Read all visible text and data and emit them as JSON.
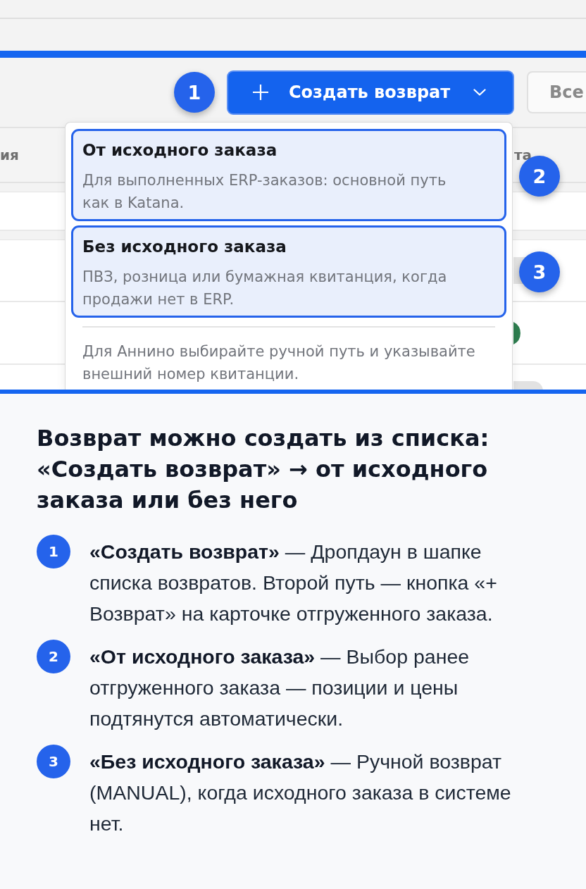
{
  "screenshot": {
    "toolbar": {
      "create_button": {
        "label": "Создать возврат"
      },
      "filter_button": {
        "label": "Все"
      }
    },
    "table": {
      "columns": [
        {
          "label": "ия"
        },
        {
          "label": "та"
        }
      ],
      "rows": [
        {
          "kind": "chip",
          "color": "#e4e4e4"
        },
        {
          "kind": "dot",
          "color": "#2e7d4f"
        },
        {
          "kind": "pill",
          "color": "#e2e2e2"
        }
      ]
    },
    "dropdown": {
      "options": [
        {
          "title": "От исходного заказа",
          "description": "Для выполненных ERP-заказов: основной путь как в Katana.",
          "highlighted": true
        },
        {
          "title": "Без исходного заказа",
          "description": "ПВЗ, розница или бумажная квитанция, когда продажи нет в ERP.",
          "highlighted": true
        }
      ],
      "note": "Для Аннино выбирайте ручной путь и указывайте внешний номер квитанции."
    },
    "callouts": [
      {
        "number": "1"
      },
      {
        "number": "2"
      },
      {
        "number": "3"
      }
    ]
  },
  "explanation": {
    "heading": "Возврат можно создать из списка: «Создать возврат» → от исходного заказа или без него",
    "steps": [
      {
        "number": "1",
        "text": "**«Создать возврат»** — Дропдаун в шапке списка возвратов. Второй путь — кнопка «+ Возврат» на карточке отгруженного заказа."
      },
      {
        "number": "2",
        "text": "**«От исходного заказа»** — Выбор ранее отгруженного заказа — позиции и цены подтянутся автоматически."
      },
      {
        "number": "3",
        "text": "**«Без исходного заказа»** — Ручной возврат (MANUAL), когда исходного заказа в системе нет."
      }
    ]
  }
}
